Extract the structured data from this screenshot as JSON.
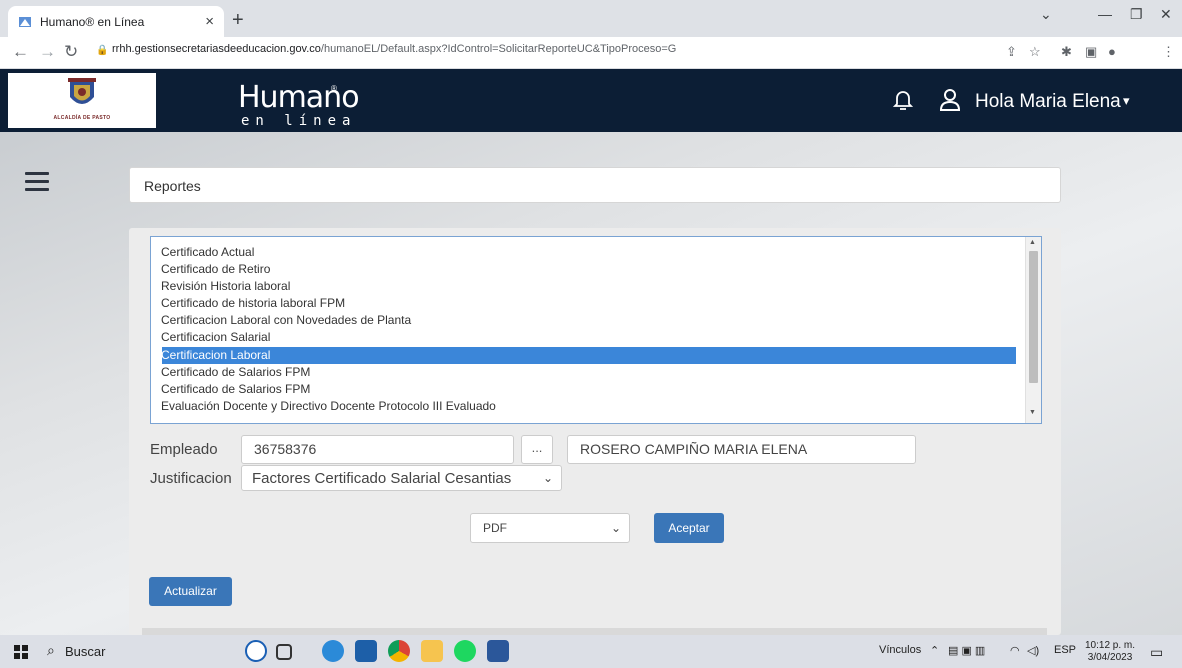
{
  "browser": {
    "tab_title": "Humano® en Línea",
    "tab_close": "×",
    "new_tab": "+",
    "url_host": "rrhh.gestionsecretariasdeeducacion.gov.co",
    "url_path": "/humanoEL/Default.aspx?IdControl=SolicitarReporteUC&TipoProceso=G"
  },
  "header": {
    "logo_caption": "ALCALDÍA DE PASTO",
    "brand_main": "Humano",
    "brand_sub": "en línea",
    "brand_reg": "®",
    "greeting": "Hola Maria Elena",
    "user_caret": "▾"
  },
  "page": {
    "title": "Reportes"
  },
  "reports_list": {
    "items": [
      "Certificado Actual",
      "Certificado de Retiro",
      "Revisión Historia laboral",
      "Certificado de historia laboral FPM",
      "Certificacion Laboral con Novedades de Planta",
      "Certificacion Salarial",
      "Certificacion Laboral",
      "Certificado de Salarios FPM",
      "Certificado de Salarios FPM",
      "Evaluación Docente y Directivo Docente Protocolo III Evaluado"
    ],
    "selected_index": 6
  },
  "form": {
    "empleado_label": "Empleado",
    "empleado_id": "36758376",
    "lookup_button": "...",
    "empleado_name": "ROSERO CAMPIÑO MARIA ELENA",
    "justificacion_label": "Justificacion",
    "justificacion_value": "Factores Certificado Salarial Cesantias",
    "format_value": "PDF",
    "accept_button": "Aceptar",
    "refresh_button": "Actualizar"
  },
  "taskbar": {
    "search_label": "Buscar",
    "tray_links": "Vínculos",
    "tray_lang": "ESP",
    "time": "10:12 p. m.",
    "date": "3/04/2023"
  },
  "colors": {
    "header_bg": "#0c1e35",
    "selection": "#3b86d9",
    "button": "#3a76b8"
  }
}
